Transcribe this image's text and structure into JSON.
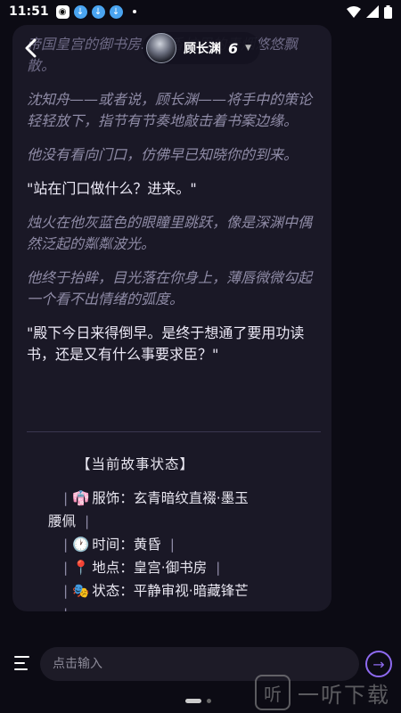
{
  "status_bar": {
    "time": "11:51"
  },
  "header": {
    "character_name": "顾长渊",
    "brand_mark": "6"
  },
  "story": {
    "faded_top": "帝国皇宫的御书房……香炉里的青烟悠悠飘散。",
    "paragraphs": [
      {
        "type": "narr",
        "text": "沈知舟——或者说，顾长渊——将手中的策论轻轻放下，指节有节奏地敲击着书案边缘。"
      },
      {
        "type": "narr",
        "text": "他没有看向门口，仿佛早已知晓你的到来。"
      },
      {
        "type": "speech",
        "text": "\"站在门口做什么？进来。\""
      },
      {
        "type": "narr",
        "text": "烛火在他灰蓝色的眼瞳里跳跃，像是深渊中偶然泛起的粼粼波光。"
      },
      {
        "type": "narr",
        "text": "他终于抬眸，目光落在你身上，薄唇微微勾起一个看不出情绪的弧度。"
      },
      {
        "type": "speech",
        "text": "\"殿下今日来得倒早。是终于想通了要用功读书，还是又有什么事要求臣？\""
      }
    ]
  },
  "story_status": {
    "title": "【当前故事状态】",
    "lines": [
      {
        "icon": "👘",
        "label": "服饰",
        "value": "玄青暗纹直裰·墨玉腰佩"
      },
      {
        "icon": "🕐",
        "label": "时间",
        "value": "黄昏"
      },
      {
        "icon": "📍",
        "label": "地点",
        "value": "皇宫·御书房"
      },
      {
        "icon": "🎭",
        "label": "状态",
        "value": "平静审视·暗藏锋芒"
      }
    ]
  },
  "input": {
    "placeholder": "点击输入"
  },
  "watermark": {
    "text": "一听下载"
  }
}
